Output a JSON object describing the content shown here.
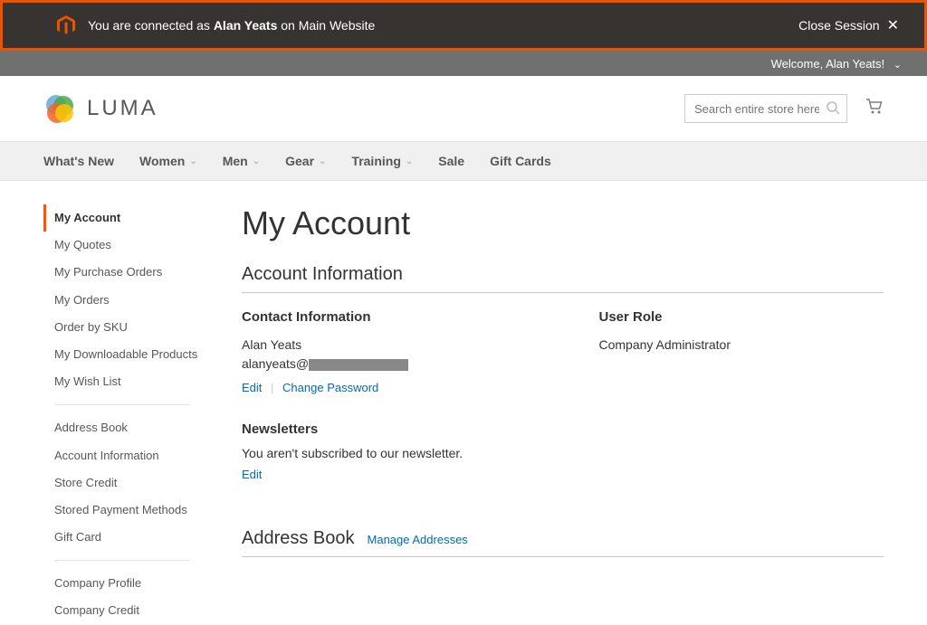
{
  "banner": {
    "prefix": "You are connected as ",
    "user": "Alan Yeats",
    "suffix": " on Main Website",
    "close": "Close Session"
  },
  "welcome": {
    "text": "Welcome, Alan Yeats!"
  },
  "header": {
    "brand": "LUMA",
    "search_placeholder": "Search entire store here..."
  },
  "nav": {
    "items": [
      "What's New",
      "Women",
      "Men",
      "Gear",
      "Training",
      "Sale",
      "Gift Cards"
    ],
    "dropdown_flags": [
      false,
      true,
      true,
      true,
      true,
      false,
      false
    ]
  },
  "sidebar": {
    "group1": [
      "My Account",
      "My Quotes",
      "My Purchase Orders",
      "My Orders",
      "Order by SKU",
      "My Downloadable Products",
      "My Wish List"
    ],
    "group2": [
      "Address Book",
      "Account Information",
      "Store Credit",
      "Stored Payment Methods",
      "Gift Card"
    ],
    "group3": [
      "Company Profile",
      "Company Credit"
    ]
  },
  "main": {
    "title": "My Account",
    "account_info_title": "Account Information",
    "contact": {
      "head": "Contact Information",
      "name": "Alan Yeats",
      "email_prefix": "alanyeats@",
      "edit": "Edit",
      "change_password": "Change Password"
    },
    "user_role": {
      "head": "User Role",
      "value": "Company Administrator"
    },
    "newsletters": {
      "head": "Newsletters",
      "body": "You aren't subscribed to our newsletter.",
      "edit": "Edit"
    },
    "address_book": {
      "title": "Address Book",
      "manage": "Manage Addresses"
    }
  }
}
